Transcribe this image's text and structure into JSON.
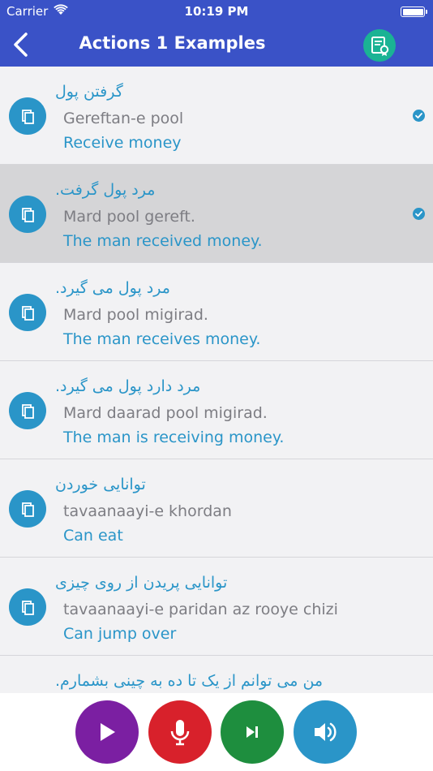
{
  "status_bar": {
    "carrier": "Carrier",
    "time": "10:19 PM"
  },
  "nav": {
    "title": "Actions 1 Examples",
    "back_icon": "chevron-left-icon",
    "action_icon": "certificate-icon"
  },
  "colors": {
    "bar": "#3a52c7",
    "accent": "#2a95c8",
    "certificate": "#1ab394",
    "play": "#7b1fa2",
    "mic": "#d8212b",
    "next": "#1e8e3e",
    "speaker": "#2a95c8"
  },
  "items": [
    {
      "persian": "گرفتن پول",
      "translit": "Gereftan-e pool",
      "english": "Receive money"
    },
    {
      "persian": "مرد پول گرفت.",
      "translit": "Mard pool gereft.",
      "english": "The man received money."
    },
    {
      "persian": "مرد پول می گیرد.",
      "translit": "Mard pool migirad.",
      "english": "The man receives money."
    },
    {
      "persian": "مرد دارد پول می گیرد.",
      "translit": "Mard daarad pool migirad.",
      "english": "The man is receiving money."
    },
    {
      "persian": "توانایی خوردن",
      "translit": "tavaanaayi-e khordan",
      "english": "Can eat"
    },
    {
      "persian": "توانایی پریدن از روی چیزی",
      "translit": "tavaanaayi-e paridan az rooye chizi",
      "english": "Can jump over"
    },
    {
      "persian": "من می توانم از یک تا ده به چینی بشمارم."
    }
  ],
  "controls": {
    "play_icon": "play-icon",
    "mic_icon": "microphone-icon",
    "next_icon": "skip-next-icon",
    "speaker_icon": "speaker-icon"
  }
}
